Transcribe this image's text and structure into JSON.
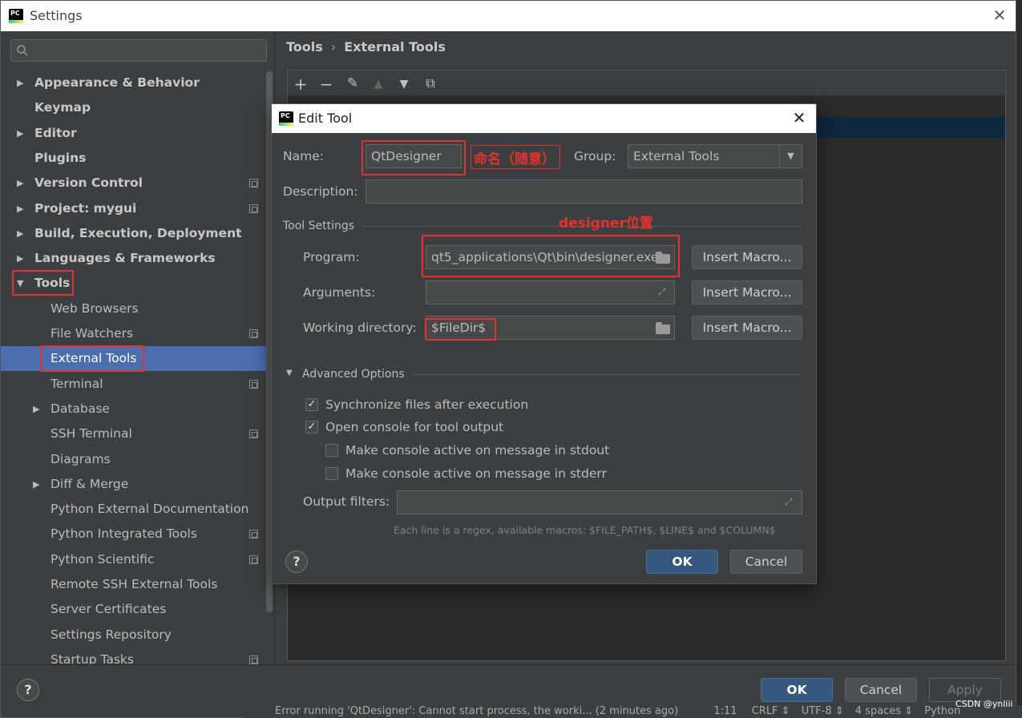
{
  "window": {
    "title": "Settings"
  },
  "search": {
    "placeholder": ""
  },
  "sidebar": {
    "items": [
      {
        "label": "Appearance & Behavior",
        "bold": true,
        "arrow": "right",
        "indent": 0,
        "cfg": false
      },
      {
        "label": "Keymap",
        "bold": true,
        "arrow": "",
        "indent": 0,
        "cfg": false
      },
      {
        "label": "Editor",
        "bold": true,
        "arrow": "right",
        "indent": 0,
        "cfg": false
      },
      {
        "label": "Plugins",
        "bold": true,
        "arrow": "",
        "indent": 0,
        "cfg": false
      },
      {
        "label": "Version Control",
        "bold": true,
        "arrow": "right",
        "indent": 0,
        "cfg": true
      },
      {
        "label": "Project: mygui",
        "bold": true,
        "arrow": "right",
        "indent": 0,
        "cfg": true
      },
      {
        "label": "Build, Execution, Deployment",
        "bold": true,
        "arrow": "right",
        "indent": 0,
        "cfg": false
      },
      {
        "label": "Languages & Frameworks",
        "bold": true,
        "arrow": "right",
        "indent": 0,
        "cfg": false
      },
      {
        "label": "Tools",
        "bold": true,
        "arrow": "down",
        "indent": 0,
        "cfg": false
      },
      {
        "label": "Web Browsers",
        "bold": false,
        "arrow": "",
        "indent": 1,
        "cfg": false
      },
      {
        "label": "File Watchers",
        "bold": false,
        "arrow": "",
        "indent": 1,
        "cfg": true
      },
      {
        "label": "External Tools",
        "bold": false,
        "arrow": "",
        "indent": 1,
        "cfg": false,
        "selected": true
      },
      {
        "label": "Terminal",
        "bold": false,
        "arrow": "",
        "indent": 1,
        "cfg": true
      },
      {
        "label": "Database",
        "bold": false,
        "arrow": "right",
        "indent": 1,
        "cfg": false
      },
      {
        "label": "SSH Terminal",
        "bold": false,
        "arrow": "",
        "indent": 1,
        "cfg": true
      },
      {
        "label": "Diagrams",
        "bold": false,
        "arrow": "",
        "indent": 1,
        "cfg": false
      },
      {
        "label": "Diff & Merge",
        "bold": false,
        "arrow": "right",
        "indent": 1,
        "cfg": false
      },
      {
        "label": "Python External Documentation",
        "bold": false,
        "arrow": "",
        "indent": 1,
        "cfg": false
      },
      {
        "label": "Python Integrated Tools",
        "bold": false,
        "arrow": "",
        "indent": 1,
        "cfg": true
      },
      {
        "label": "Python Scientific",
        "bold": false,
        "arrow": "",
        "indent": 1,
        "cfg": true
      },
      {
        "label": "Remote SSH External Tools",
        "bold": false,
        "arrow": "",
        "indent": 1,
        "cfg": false
      },
      {
        "label": "Server Certificates",
        "bold": false,
        "arrow": "",
        "indent": 1,
        "cfg": false
      },
      {
        "label": "Settings Repository",
        "bold": false,
        "arrow": "",
        "indent": 1,
        "cfg": false
      },
      {
        "label": "Startup Tasks",
        "bold": false,
        "arrow": "",
        "indent": 1,
        "cfg": true
      }
    ]
  },
  "breadcrumb": {
    "parent": "Tools",
    "separator": "›",
    "current": "External Tools"
  },
  "ext_toolbar": {
    "icons": [
      "plus-icon",
      "minus-icon",
      "pencil-icon",
      "arrow-up-icon",
      "arrow-down-icon",
      "copy-icon"
    ]
  },
  "dialog": {
    "title": "Edit Tool",
    "name_label": "Name:",
    "name_value": "QtDesigner",
    "name_note": "命名（随意）",
    "group_label": "Group:",
    "group_value": "External Tools",
    "description_label": "Description:",
    "description_value": "",
    "tool_settings_title": "Tool Settings",
    "designer_note": "designer位置",
    "program_label": "Program:",
    "program_value": "qt5_applications\\Qt\\bin\\designer.exe",
    "arguments_label": "Arguments:",
    "arguments_value": "",
    "workdir_label": "Working directory:",
    "workdir_value": "$FileDir$",
    "insert_macro_label": "Insert Macro...",
    "advanced_title": "Advanced Options",
    "sync_label": "Synchronize files after execution",
    "sync_checked": true,
    "console_label": "Open console for tool output",
    "console_checked": true,
    "stdout_label": "Make console active on message in stdout",
    "stdout_checked": false,
    "stderr_label": "Make console active on message in stderr",
    "stderr_checked": false,
    "output_filters_label": "Output filters:",
    "output_filters_value": "",
    "hint": "Each line is a regex, available macros: $FILE_PATH$, $LINE$ and $COLUMN$",
    "ok_label": "OK",
    "cancel_label": "Cancel",
    "help_label": "?"
  },
  "footer": {
    "ok_label": "OK",
    "cancel_label": "Cancel",
    "apply_label": "Apply",
    "help_label": "?"
  },
  "statusbar": {
    "text": "Error running 'QtDesigner': Cannot start process, the worki... (2 minutes ago)",
    "position": "1:11",
    "line_sep": "CRLF ⇕",
    "encoding": "UTF-8 ⇕",
    "indent": "4 spaces ⇕",
    "interpreter": "Python"
  },
  "watermark": "CSDN @ynliii",
  "colors": {
    "selection": "#4b6eaf",
    "primary_button": "#365880",
    "annotation": "#e5312c"
  }
}
